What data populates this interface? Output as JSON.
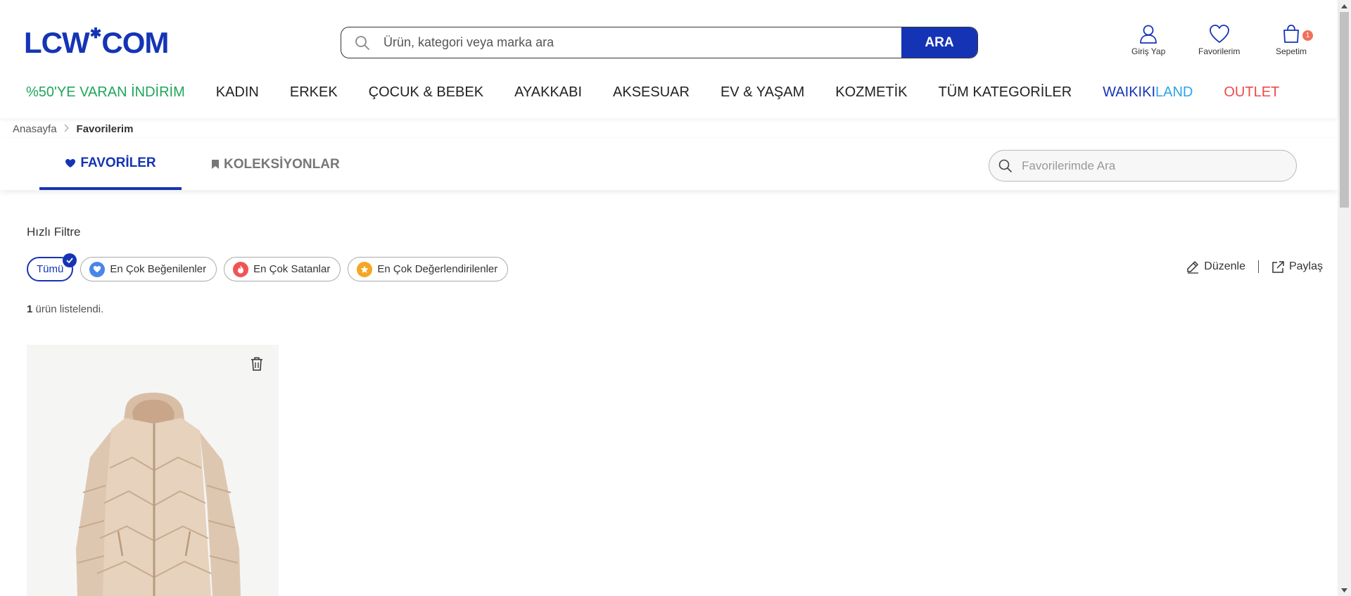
{
  "header": {
    "logo_left": "LCW",
    "logo_star": "✱",
    "logo_right": "COM",
    "search_placeholder": "Ürün, kategori veya marka ara",
    "search_button": "ARA",
    "login_label": "Giriş Yap",
    "favorites_label": "Favorilerim",
    "cart_label": "Sepetim",
    "cart_count": "1"
  },
  "nav": {
    "discount": "%50'YE VARAN İNDİRİM",
    "women": "KADIN",
    "men": "ERKEK",
    "kids": "ÇOCUK & BEBEK",
    "shoes": "AYAKKABI",
    "accessories": "AKSESUAR",
    "home": "EV & YAŞAM",
    "cosmetics": "KOZMETİK",
    "all_categories": "TÜM KATEGORİLER",
    "waikiki": "WAIKIKI",
    "land": "LAND",
    "outlet": "OUTLET"
  },
  "breadcrumb": {
    "home": "Anasayfa",
    "current": "Favorilerim"
  },
  "tabs": {
    "favorites": "FAVORİLER",
    "collections": "KOLEKSİYONLAR",
    "search_placeholder": "Favorilerimde Ara"
  },
  "filters": {
    "title": "Hızlı Filtre",
    "all": "Tümü",
    "most_liked": "En Çok Beğenilenler",
    "best_selling": "En Çok Satanlar",
    "most_rated": "En Çok Değerlendirilenler"
  },
  "actions": {
    "edit": "Düzenle",
    "share": "Paylaş"
  },
  "results": {
    "count": "1",
    "count_text": " ürün listelendi."
  },
  "colors": {
    "brand_blue": "#1534b5",
    "discount_green": "#1fa65a",
    "outlet_red": "#f04848",
    "land_blue": "#2fa4e7",
    "cart_badge": "#f26f5c"
  }
}
